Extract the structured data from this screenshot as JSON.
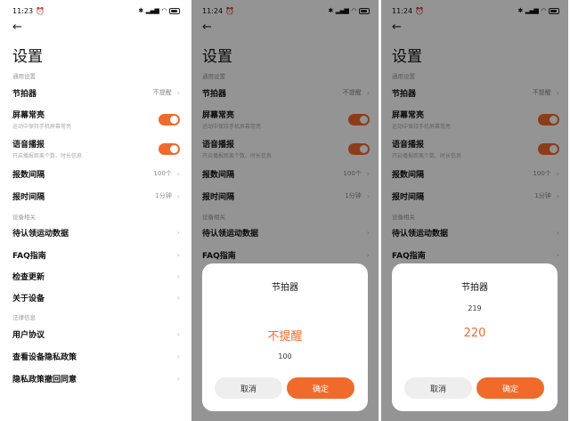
{
  "screens": [
    {
      "time": "11:23",
      "page_title": "设置",
      "sections": [
        {
          "label": "通用设置",
          "items": [
            {
              "name": "节拍器",
              "value": "不提醒",
              "type": "value"
            },
            {
              "name": "屏幕常亮",
              "desc": "运动中保持手机屏幕常亮",
              "type": "toggle",
              "on": true
            },
            {
              "name": "语音播报",
              "desc": "开启播报距离个数、时长信息",
              "type": "toggle",
              "on": true
            },
            {
              "name": "报数间隔",
              "value": "100个",
              "type": "value"
            },
            {
              "name": "报时间隔",
              "value": "1分钟",
              "type": "value"
            }
          ]
        },
        {
          "label": "设备相关",
          "items": [
            {
              "name": "待认领运动数据",
              "type": "chevron"
            },
            {
              "name": "FAQ指南",
              "type": "chevron"
            },
            {
              "name": "检查更新",
              "type": "chevron"
            },
            {
              "name": "关于设备",
              "type": "chevron"
            }
          ]
        },
        {
          "label": "法律信息",
          "items": [
            {
              "name": "用户协议",
              "type": "chevron"
            },
            {
              "name": "查看设备隐私政策",
              "type": "chevron"
            },
            {
              "name": "隐私政策撤回同意",
              "type": "chevron"
            }
          ]
        }
      ]
    },
    {
      "time": "11:24",
      "page_title": "设置",
      "section_general": "通用设置",
      "section_device": "设备相关",
      "items": {
        "metronome": {
          "name": "节拍器",
          "value": "不提醒"
        },
        "screen_on": {
          "name": "屏幕常亮",
          "desc": "运动中保持手机屏幕常亮"
        },
        "voice": {
          "name": "语音播报",
          "desc": "开启播报距离个数、时长信息"
        },
        "count_interval": {
          "name": "报数间隔",
          "value": "100个"
        },
        "time_interval": {
          "name": "报时间隔",
          "value": "1分钟"
        },
        "unclaimed": {
          "name": "待认领运动数据"
        },
        "faq": {
          "name": "FAQ指南"
        }
      },
      "sheet": {
        "title": "节拍器",
        "selected": "不提醒",
        "next": "100",
        "cancel": "取消",
        "confirm": "确定"
      }
    },
    {
      "time": "11:24",
      "page_title": "设置",
      "section_general": "通用设置",
      "section_device": "设备相关",
      "items": {
        "metronome": {
          "name": "节拍器",
          "value": "不提醒"
        },
        "screen_on": {
          "name": "屏幕常亮",
          "desc": "运动中保持手机屏幕常亮"
        },
        "voice": {
          "name": "语音播报",
          "desc": "开启播报距离个数、时长信息"
        },
        "count_interval": {
          "name": "报数间隔",
          "value": "100个"
        },
        "time_interval": {
          "name": "报时间隔",
          "value": "1分钟"
        },
        "unclaimed": {
          "name": "待认领运动数据"
        },
        "faq": {
          "name": "FAQ指南"
        }
      },
      "sheet": {
        "title": "节拍器",
        "prev": "219",
        "selected": "220",
        "cancel": "取消",
        "confirm": "确定"
      }
    }
  ],
  "colors": {
    "accent": "#f06a2c",
    "overlay": "rgba(0,0,0,0.42)"
  },
  "icons": [
    "back-arrow-icon",
    "chevron-right-icon",
    "toggle-switch",
    "bluetooth-icon",
    "signal-icon",
    "wifi-icon",
    "battery-icon",
    "alarm-icon",
    "notification-icon"
  ]
}
